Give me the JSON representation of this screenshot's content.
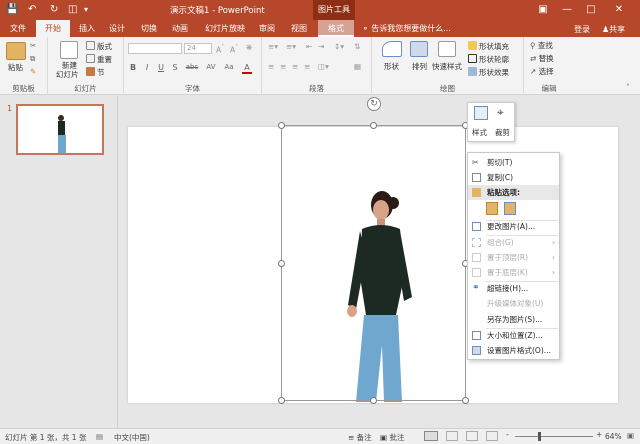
{
  "titlebar": {
    "title": "演示文稿1 - PowerPoint",
    "picture_tools": "图片工具",
    "login": "登录",
    "share": "共享",
    "accent": "#b7472a"
  },
  "tabs": [
    "文件",
    "开始",
    "插入",
    "设计",
    "切换",
    "动画",
    "幻灯片放映",
    "审阅",
    "视图",
    "格式"
  ],
  "active_tab": "开始",
  "search_placeholder": "告诉我您想要做什么...",
  "ribbon": {
    "clipboard": {
      "paste": "粘贴",
      "label": "剪贴板"
    },
    "slides": {
      "new_slide": "新建",
      "new_slide2": "幻灯片",
      "layout": "版式",
      "reset": "重置",
      "section": "节",
      "label": "幻灯片"
    },
    "font": {
      "size": "24",
      "label": "字体",
      "buttons": [
        "B",
        "I",
        "U",
        "S",
        "abc",
        "AV",
        "Aa",
        "A"
      ]
    },
    "paragraph": {
      "label": "段落"
    },
    "drawing": {
      "shape": "形状",
      "arrange": "排列",
      "quick_styles": "快速样式",
      "fill": "形状填充",
      "outline": "形状轮廓",
      "effects": "形状效果",
      "label": "绘图"
    },
    "editing": {
      "find": "查找",
      "replace": "替换",
      "select": "选择",
      "label": "编辑"
    }
  },
  "thumb_number": "1",
  "mini_toolbar": {
    "style": "样式",
    "crop": "裁剪"
  },
  "context_menu": [
    {
      "label": "剪切(T)",
      "icon": "scissors-icon",
      "disabled": false
    },
    {
      "label": "复制(C)",
      "icon": "copy-icon",
      "disabled": false
    },
    {
      "label": "粘贴选项:",
      "icon": "paste-icon",
      "disabled": false,
      "header": true
    },
    {
      "label": "更改图片(A)...",
      "icon": "change-picture-icon",
      "disabled": false
    },
    {
      "label": "组合(G)",
      "icon": "group-icon",
      "disabled": true,
      "submenu": true
    },
    {
      "label": "置于顶层(R)",
      "icon": "bring-front-icon",
      "disabled": true,
      "submenu": true
    },
    {
      "label": "置于底层(K)",
      "icon": "send-back-icon",
      "disabled": true,
      "submenu": true
    },
    {
      "label": "超链接(H)...",
      "icon": "hyperlink-icon",
      "disabled": false
    },
    {
      "label": "升级媒体对象(U)",
      "icon": "",
      "disabled": true
    },
    {
      "label": "另存为图片(S)...",
      "icon": "",
      "disabled": false
    },
    {
      "label": "大小和位置(Z)...",
      "icon": "size-position-icon",
      "disabled": false
    },
    {
      "label": "设置图片格式(O)...",
      "icon": "format-picture-icon",
      "disabled": false
    }
  ],
  "statusbar": {
    "slide_info": "幻灯片 第 1 张，共 1 张",
    "language": "中文(中国)",
    "notes": "备注",
    "comments": "批注",
    "zoom": "64%",
    "minus": "-",
    "plus": "+"
  }
}
